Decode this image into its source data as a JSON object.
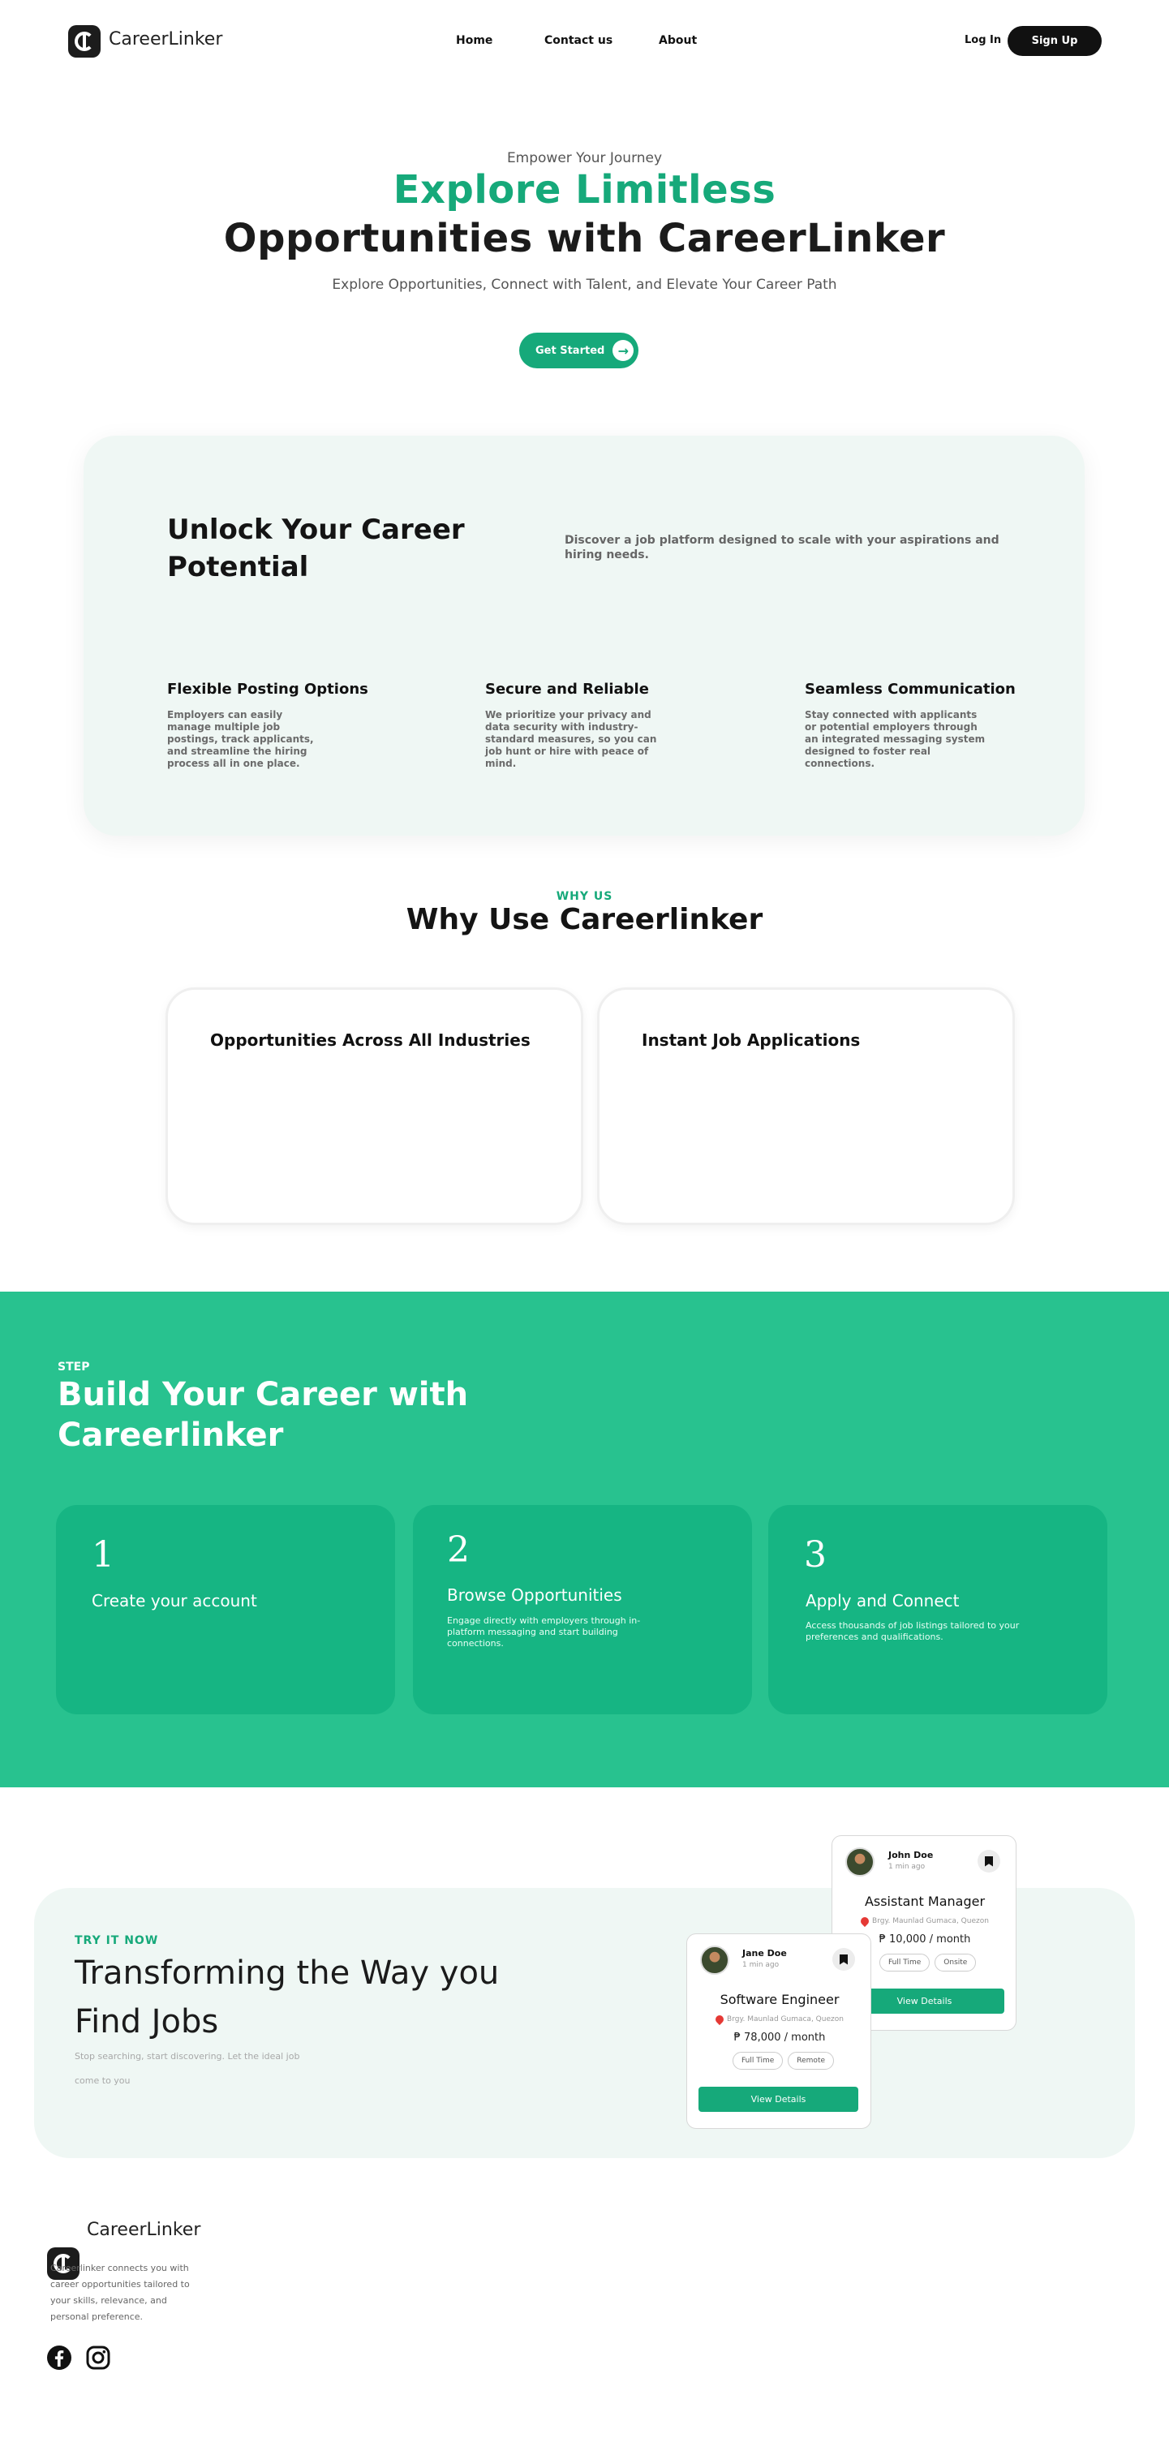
{
  "nav": {
    "brand": "CareerLinker",
    "links": [
      "Home",
      "Contact us",
      "About"
    ],
    "login": "Log In",
    "signup": "Sign Up"
  },
  "hero": {
    "eyebrow": "Empower Your Journey",
    "title_green": "Explore Limitless",
    "title_dark": "Opportunities with CareerLinker",
    "subtitle": "Explore Opportunities, Connect with Talent, and Elevate Your Career Path",
    "cta": "Get Started"
  },
  "unlock": {
    "title": "Unlock Your Career Potential",
    "description": "Discover a job platform designed to scale with your aspirations and hiring needs.",
    "features": [
      {
        "title": "Flexible Posting Options",
        "desc": "Employers can easily manage multiple job postings, track applicants, and streamline the hiring process all in one place."
      },
      {
        "title": "Secure and Reliable",
        "desc": "We prioritize your privacy and data security with industry-standard measures, so you can job hunt or hire with peace of mind."
      },
      {
        "title": "Seamless Communication",
        "desc": "Stay connected with applicants or potential employers through an integrated messaging system designed to foster real connections."
      }
    ]
  },
  "why": {
    "eyebrow": "WHY US",
    "title": "Why Use Careerlinker",
    "cards": [
      "Opportunities Across All Industries",
      "Instant Job Applications"
    ]
  },
  "steps": {
    "eyebrow": "STEP",
    "title": "Build Your Career with Careerlinker",
    "items": [
      {
        "num": "1",
        "title": "Create your account",
        "desc": ""
      },
      {
        "num": "2",
        "title": "Browse Opportunities",
        "desc": "Engage directly with employers through in-platform messaging and start building connections."
      },
      {
        "num": "3",
        "title": "Apply and Connect",
        "desc": "Access thousands of job listings tailored to your preferences and qualifications."
      }
    ]
  },
  "try": {
    "eyebrow": "TRY IT NOW",
    "title": "Transforming the Way you Find Jobs",
    "desc": "Stop searching, start discovering. Let the ideal job come to you",
    "cards": [
      {
        "name": "John Doe",
        "time": "1 min ago",
        "job": "Assistant Manager",
        "location": "Brgy. Maunlad Gumaca, Quezon",
        "salary": "₱ 10,000 / month",
        "tags": [
          "Full Time",
          "Onsite"
        ],
        "button": "View Details"
      },
      {
        "name": "Jane Doe",
        "time": "1 min ago",
        "job": "Software Engineer",
        "location": "Brgy. Maunlad Gumaca, Quezon",
        "salary": "₱ 78,000 / month",
        "tags": [
          "Full Time",
          "Remote"
        ],
        "button": "View Details"
      }
    ]
  },
  "footer": {
    "brand": "CareerLinker",
    "desc": "Careerlinker connects you with career opportunities tailored to your skills, relevance, and personal preference.",
    "social": [
      "facebook-icon",
      "instagram-icon"
    ]
  },
  "colors": {
    "accent": "#16a97a",
    "band": "#28c28f",
    "panel": "#eff7f4"
  }
}
